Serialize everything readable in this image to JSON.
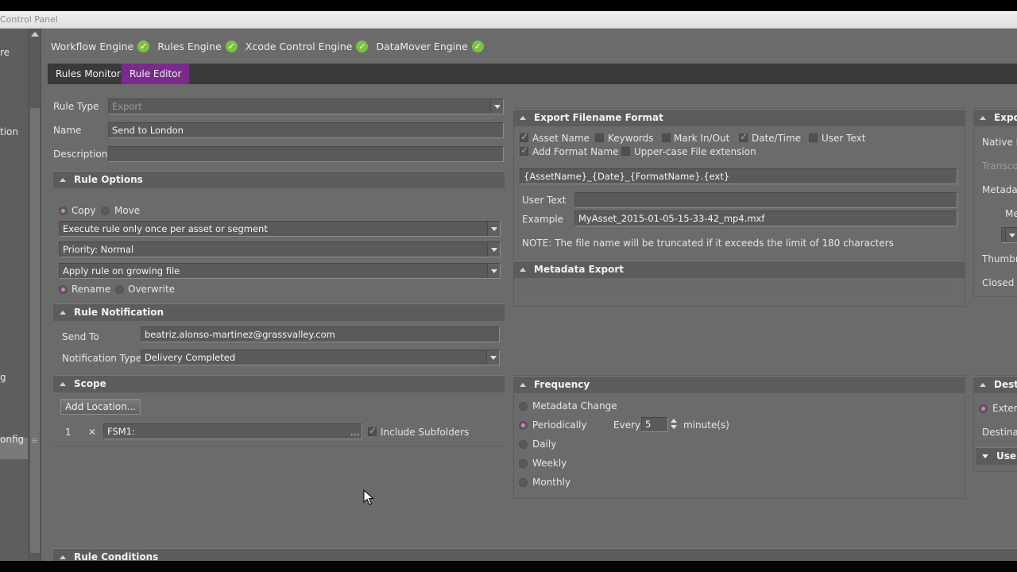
{
  "window": {
    "title": "Control Panel"
  },
  "left_strip": {
    "labels": [
      "re",
      "tion",
      "g",
      "onfig"
    ]
  },
  "engines": [
    {
      "label": "Workflow Engine",
      "status": "ok"
    },
    {
      "label": "Rules Engine",
      "status": "ok"
    },
    {
      "label": "Xcode Control Engine",
      "status": "ok"
    },
    {
      "label": "DataMover Engine",
      "status": "ok"
    }
  ],
  "tabs": [
    {
      "label": "Rules Monitor",
      "active": false
    },
    {
      "label": "Rule Editor",
      "active": true
    }
  ],
  "rule": {
    "type_label": "Rule Type",
    "type_value": "Export",
    "name_label": "Name",
    "name_value": "Send to London",
    "description_label": "Description",
    "description_value": ""
  },
  "rule_options": {
    "title": "Rule Options",
    "copy_label": "Copy",
    "move_label": "Move",
    "execute_value": "Execute rule only once per asset or segment",
    "priority_value": "Priority: Normal",
    "growing_value": "Apply rule on growing file",
    "rename_label": "Rename",
    "overwrite_label": "Overwrite"
  },
  "notification": {
    "title": "Rule Notification",
    "send_to_label": "Send To",
    "send_to_value": "beatriz.alonso-martinez@grassvalley.com",
    "type_label": "Notification Type",
    "type_value": "Delivery Completed"
  },
  "scope": {
    "title": "Scope",
    "add_location_label": "Add Location...",
    "row_index": "1",
    "remove_glyph": "✕",
    "location_value": "FSM1:",
    "browse_label": "...",
    "include_subfolders_label": "Include Subfolders"
  },
  "export_filename": {
    "title": "Export Filename Format",
    "asset_name_label": "Asset Name",
    "keywords_label": "Keywords",
    "mark_in_out_label": "Mark In/Out",
    "date_time_label": "Date/Time",
    "user_text_cb_label": "User Text",
    "add_format_name_label": "Add Format Name",
    "upper_case_label": "Upper-case File extension",
    "pattern_value": "{AssetName}_{Date}_{FormatName}.{ext}",
    "user_text_label": "User Text",
    "user_text_value": "",
    "example_label": "Example",
    "example_value": "MyAsset_2015-01-05-15-33-42_mp4.mxf",
    "note": "NOTE: The file name will be truncated if it exceeds the limit of 180 characters"
  },
  "metadata_export": {
    "title": "Metadata Export"
  },
  "frequency": {
    "title": "Frequency",
    "metadata_change_label": "Metadata Change",
    "periodically_label": "Periodically",
    "every_label": "Every",
    "every_value": "5",
    "minutes_label": "minute(s)",
    "daily_label": "Daily",
    "weekly_label": "Weekly",
    "monthly_label": "Monthly"
  },
  "right_clipped": {
    "export_title": "Expo",
    "native_label": "Native F",
    "transcode_label": "Transco",
    "metadata_label": "Metadat",
    "me_label": "Me",
    "thumb_label": "Thumbr",
    "closed_label": "Closed C",
    "dest_title": "Dest",
    "external_label": "Exter",
    "destination_label": "Destinat",
    "use_label": "Use"
  },
  "rule_conditions": {
    "title": "Rule Conditions"
  },
  "colors": {
    "accent": "#7a2a8a",
    "check_green": "#7dc242",
    "radio_pink": "#d57ad9"
  }
}
